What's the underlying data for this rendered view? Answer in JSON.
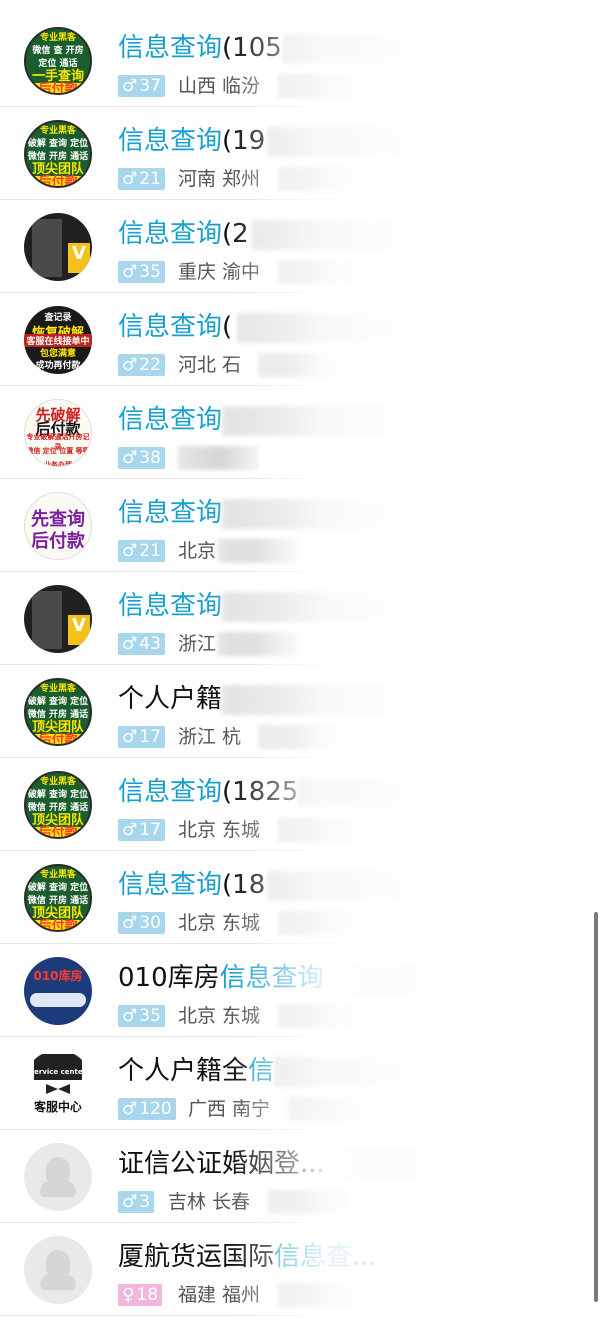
{
  "items": [
    {
      "title_plain": "",
      "title_hl": "信息查询",
      "title_rest": "(105",
      "badge_gender": "male",
      "age": "37",
      "location": "山西 临汾",
      "avatar": {
        "type": "green",
        "lines": [
          "专业黑客",
          "微信 查 开房",
          "定位 通话",
          "一手查询价格公道",
          "后付款"
        ]
      }
    },
    {
      "title_plain": "",
      "title_hl": "信息查询",
      "title_rest": "(19",
      "badge_gender": "male",
      "age": "21",
      "location": "河南 郑州",
      "avatar": {
        "type": "green",
        "lines": [
          "专业黑客",
          "破解 查询 定位",
          "微信 开房 通话",
          "顶尖团队",
          "后付款"
        ]
      }
    },
    {
      "title_plain": "",
      "title_hl": "信息查询",
      "title_rest": "(2",
      "badge_gender": "male",
      "age": "35",
      "location": "重庆 渝中",
      "avatar": {
        "type": "dark",
        "lines": [
          "V"
        ]
      }
    },
    {
      "title_plain": "",
      "title_hl": "信息查询",
      "title_rest": "(",
      "badge_gender": "male",
      "age": "22",
      "location": "河北 石",
      "avatar": {
        "type": "red",
        "lines": [
          "查记录",
          "恢复破解",
          "客服在线接单中",
          "包您满意",
          "成功再付款"
        ]
      }
    },
    {
      "title_plain": "",
      "title_hl": "信息查询",
      "title_rest": "",
      "badge_gender": "male",
      "age": "38",
      "location": "",
      "avatar": {
        "type": "white",
        "lines": [
          "先破解",
          "后付款",
          "专业破解通话开房记录",
          "微信 定位 位置 等等",
          "业务办理"
        ]
      }
    },
    {
      "title_plain": "",
      "title_hl": "信息查询",
      "title_rest": "",
      "badge_gender": "male",
      "age": "21",
      "location": "北京",
      "avatar": {
        "type": "white",
        "lines": [
          "先查询",
          "后付款"
        ]
      }
    },
    {
      "title_plain": "",
      "title_hl": "信息查询",
      "title_rest": "",
      "badge_gender": "male",
      "age": "43",
      "location": "浙江",
      "avatar": {
        "type": "dark",
        "lines": [
          "V"
        ]
      }
    },
    {
      "title_plain": "个人户籍",
      "title_hl": "",
      "title_rest": "",
      "badge_gender": "male",
      "age": "17",
      "location": "浙江 杭",
      "avatar": {
        "type": "green",
        "lines": [
          "专业黑客",
          "破解 查询 定位",
          "微信 开房 通话",
          "顶尖团队",
          "后付款"
        ]
      }
    },
    {
      "title_plain": "",
      "title_hl": "信息查询",
      "title_rest": "(1825",
      "badge_gender": "male",
      "age": "17",
      "location": "北京 东城",
      "avatar": {
        "type": "green",
        "lines": [
          "专业黑客",
          "破解 查询 定位",
          "微信 开房 通话",
          "顶尖团队",
          "后付款"
        ]
      }
    },
    {
      "title_plain": "",
      "title_hl": "信息查询",
      "title_rest": "(18",
      "badge_gender": "male",
      "age": "30",
      "location": "北京 东城",
      "avatar": {
        "type": "green",
        "lines": [
          "专业黑客",
          "破解 查询 定位",
          "微信 开房 通话",
          "顶尖团队",
          "后付款"
        ]
      }
    },
    {
      "title_plain": "010库房",
      "title_hl": "信息查询",
      "title_rest": "",
      "badge_gender": "male",
      "age": "35",
      "location": "北京 东城",
      "avatar": {
        "type": "blue",
        "lines": [
          "010库房"
        ]
      }
    },
    {
      "title_plain": "个人户籍全",
      "title_hl": "信",
      "title_rest": "",
      "badge_gender": "male",
      "age": "120",
      "location": "广西 南宁",
      "avatar": {
        "type": "hat",
        "lines": [
          "service center",
          "客服中心"
        ]
      }
    },
    {
      "title_plain": "证信公证婚姻登",
      "title_hl": "",
      "title_rest": "...",
      "badge_gender": "male",
      "age": "3",
      "location": "吉林 长春",
      "avatar": {
        "type": "grey",
        "lines": []
      }
    },
    {
      "title_plain": "厦航货运国际",
      "title_hl": "信息查",
      "title_rest": "...",
      "badge_gender": "female",
      "age": "18",
      "location": "福建 福州",
      "avatar": {
        "type": "grey",
        "lines": []
      }
    }
  ],
  "colors": {
    "highlight": "#1aa0d0",
    "male_badge": "#a8d6ec",
    "female_badge": "#f0b6dd"
  },
  "symbols": {
    "male": "♂",
    "female": "♀"
  }
}
